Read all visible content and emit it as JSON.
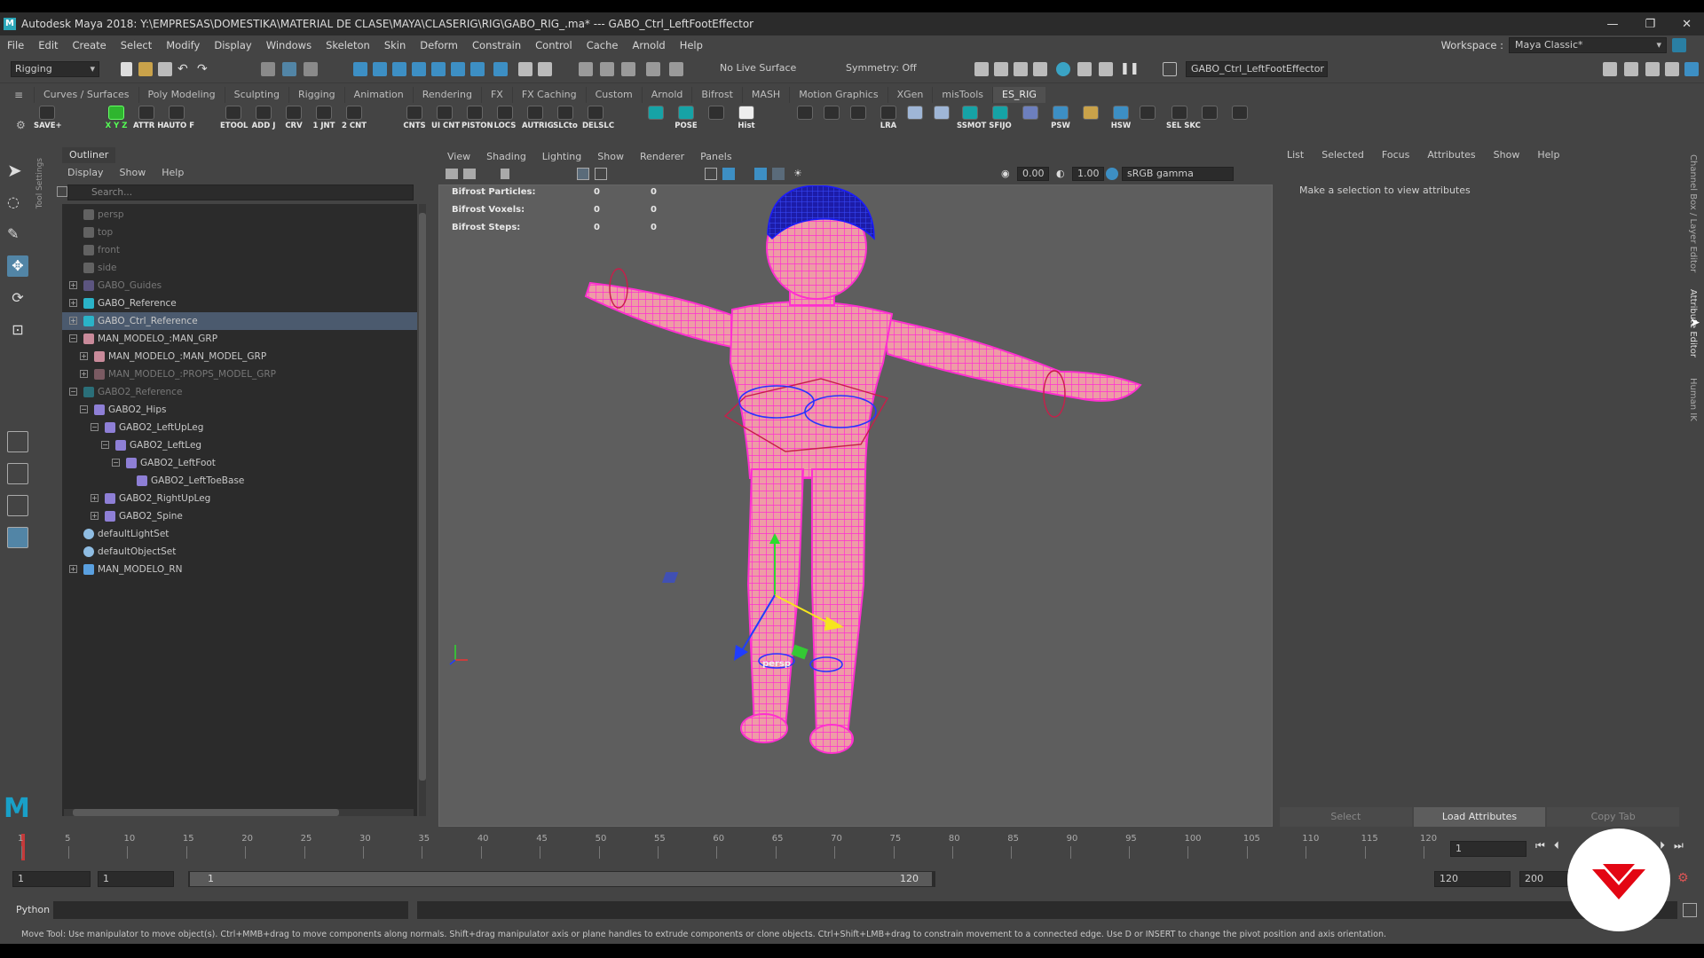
{
  "title_bar": {
    "app_title": "Autodesk Maya 2018: Y:\\EMPRESAS\\DOMESTIKA\\MATERIAL DE CLASE\\MAYA\\CLASERIG\\RIG\\GABO_RIG_.ma*  ---  GABO_Ctrl_LeftFootEffector"
  },
  "menu_bar": {
    "items": [
      "File",
      "Edit",
      "Create",
      "Select",
      "Modify",
      "Display",
      "Windows",
      "Skeleton",
      "Skin",
      "Deform",
      "Constrain",
      "Control",
      "Cache",
      "Arnold",
      "Help"
    ],
    "workspace_label": "Workspace :",
    "workspace_value": "Maya Classic*"
  },
  "status_line": {
    "mode": "Rigging",
    "live_surface": "No Live Surface",
    "symmetry": "Symmetry: Off",
    "selection_field": "GABO_Ctrl_LeftFootEffector"
  },
  "shelf": {
    "tabs": [
      "Curves / Surfaces",
      "Poly Modeling",
      "Sculpting",
      "Rigging",
      "Animation",
      "Rendering",
      "FX",
      "FX Caching",
      "Custom",
      "Arnold",
      "Bifrost",
      "MASH",
      "Motion Graphics",
      "XGen",
      "misTools",
      "ES_RIG"
    ],
    "active_tab": "ES_RIG",
    "buttons": [
      "SAVE+",
      "X Y Z",
      "ATTR H",
      "AUTO F",
      "ETOOL",
      "ADD J",
      "CRV",
      "1 JNT",
      "2 CNT",
      "CNTS",
      "UI CNT",
      "PISTON",
      "LOCS",
      "AUTRIG",
      "SLCto",
      "DELSLC",
      "POSE",
      "Hist",
      "LRA",
      "SSMOT",
      "SFIJO",
      "PSW",
      "HSW",
      "SEL SKC"
    ]
  },
  "toolbox": {
    "side_label": "Tool Settings"
  },
  "outliner": {
    "tab": "Outliner",
    "menu": [
      "Display",
      "Show",
      "Help"
    ],
    "search_placeholder": "Search...",
    "items": [
      {
        "label": "persp",
        "icon": "camera-icon",
        "indent": 0,
        "expander": "",
        "dim": true,
        "selected": false
      },
      {
        "label": "top",
        "icon": "camera-icon",
        "indent": 0,
        "expander": "",
        "dim": true,
        "selected": false
      },
      {
        "label": "front",
        "icon": "camera-icon",
        "indent": 0,
        "expander": "",
        "dim": true,
        "selected": false
      },
      {
        "label": "side",
        "icon": "camera-icon",
        "indent": 0,
        "expander": "",
        "dim": true,
        "selected": false
      },
      {
        "label": "GABO_Guides",
        "icon": "joint-icon",
        "indent": 0,
        "expander": "+",
        "dim": true,
        "selected": false
      },
      {
        "label": "GABO_Reference",
        "icon": "star-joint-icon",
        "indent": 0,
        "expander": "+",
        "dim": false,
        "selected": false
      },
      {
        "label": "GABO_Ctrl_Reference",
        "icon": "star-joint-icon",
        "indent": 0,
        "expander": "+",
        "dim": false,
        "selected": true
      },
      {
        "label": "MAN_MODELO_:MAN_GRP",
        "icon": "group-icon",
        "indent": 0,
        "expander": "−",
        "dim": false,
        "selected": false
      },
      {
        "label": "MAN_MODELO_:MAN_MODEL_GRP",
        "icon": "group-icon",
        "indent": 1,
        "expander": "+",
        "dim": false,
        "selected": false
      },
      {
        "label": "MAN_MODELO_:PROPS_MODEL_GRP",
        "icon": "group-icon",
        "indent": 1,
        "expander": "+",
        "dim": true,
        "selected": false
      },
      {
        "label": "GABO2_Reference",
        "icon": "star-joint-icon",
        "indent": 0,
        "expander": "−",
        "dim": true,
        "selected": false
      },
      {
        "label": "GABO2_Hips",
        "icon": "joint-icon",
        "indent": 1,
        "expander": "−",
        "dim": false,
        "selected": false
      },
      {
        "label": "GABO2_LeftUpLeg",
        "icon": "joint-icon",
        "indent": 2,
        "expander": "−",
        "dim": false,
        "selected": false
      },
      {
        "label": "GABO2_LeftLeg",
        "icon": "joint-icon",
        "indent": 3,
        "expander": "−",
        "dim": false,
        "selected": false
      },
      {
        "label": "GABO2_LeftFoot",
        "icon": "joint-icon",
        "indent": 4,
        "expander": "−",
        "dim": false,
        "selected": false
      },
      {
        "label": "GABO2_LeftToeBase",
        "icon": "joint-icon",
        "indent": 5,
        "expander": "",
        "dim": false,
        "selected": false
      },
      {
        "label": "GABO2_RightUpLeg",
        "icon": "joint-icon",
        "indent": 2,
        "expander": "+",
        "dim": false,
        "selected": false
      },
      {
        "label": "GABO2_Spine",
        "icon": "joint-icon",
        "indent": 2,
        "expander": "+",
        "dim": false,
        "selected": false
      },
      {
        "label": "defaultLightSet",
        "icon": "set-icon",
        "indent": 0,
        "expander": "",
        "dim": false,
        "selected": false
      },
      {
        "label": "defaultObjectSet",
        "icon": "set-icon",
        "indent": 0,
        "expander": "",
        "dim": false,
        "selected": false
      },
      {
        "label": "MAN_MODELO_RN",
        "icon": "reference-node-icon",
        "indent": 0,
        "expander": "+",
        "dim": false,
        "selected": false
      }
    ]
  },
  "viewport": {
    "menu": [
      "View",
      "Shading",
      "Lighting",
      "Show",
      "Renderer",
      "Panels"
    ],
    "exposure": "0.00",
    "gamma": "1.00",
    "color_space": "sRGB gamma",
    "hud": [
      {
        "label": "Bifrost Particles:",
        "v1": "0",
        "v2": "0"
      },
      {
        "label": "Bifrost Voxels:",
        "v1": "0",
        "v2": "0"
      },
      {
        "label": "Bifrost Steps:",
        "v1": "0",
        "v2": "0"
      }
    ],
    "camera_label": "persp"
  },
  "attribute_editor": {
    "menu": [
      "List",
      "Selected",
      "Focus",
      "Attributes",
      "Show",
      "Help"
    ],
    "message": "Make a selection to view attributes",
    "buttons": {
      "select": "Select",
      "load": "Load Attributes",
      "copy": "Copy Tab"
    },
    "side_tabs": [
      "Channel Box / Layer Editor",
      "Attribute Editor",
      "Human IK"
    ]
  },
  "time_slider": {
    "ticks": [
      "1",
      "5",
      "10",
      "15",
      "20",
      "25",
      "30",
      "35",
      "40",
      "45",
      "50",
      "55",
      "60",
      "65",
      "70",
      "75",
      "80",
      "85",
      "90",
      "95",
      "100",
      "105",
      "110",
      "115",
      "120"
    ],
    "current_frame": "1"
  },
  "range_slider": {
    "start": "1",
    "playback_start": "1",
    "range_inner_start": "1",
    "range_inner_end": "120",
    "playback_end": "120",
    "end": "200"
  },
  "command_line": {
    "language": "Python"
  },
  "help_line": {
    "text": "Move Tool: Use manipulator to move object(s). Ctrl+MMB+drag to move components along normals. Shift+drag manipulator axis or plane handles to extrude components or clone objects. Ctrl+Shift+LMB+drag to constrain movement to a connected edge. Use D or INSERT to change the pivot position and axis orientation."
  },
  "colors": {
    "accent_selection": "#5285a6",
    "wireframe": "#ff2fd0",
    "skin": "#e89aa0",
    "hair": "#1c1ca8",
    "logo_red": "#e30613"
  }
}
